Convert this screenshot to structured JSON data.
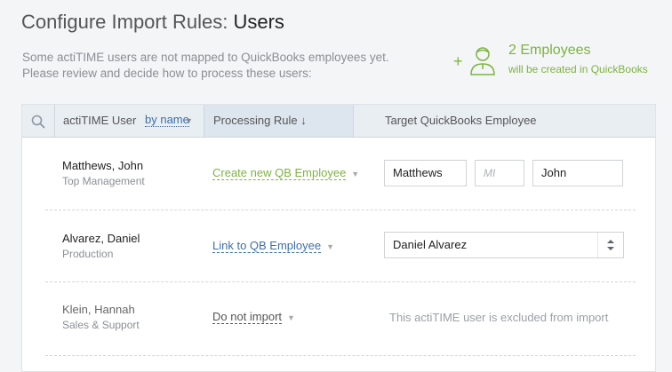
{
  "page": {
    "title_prefix": "Configure Import Rules:",
    "title_subject": "Users",
    "description_line1": "Some actiTIME users are not mapped to QuickBooks employees yet.",
    "description_line2": "Please review and decide how to process these users:"
  },
  "summary": {
    "plus": "+",
    "count": "2 Employees",
    "subtitle": "will be created in QuickBooks",
    "icon": "user-add-icon",
    "color": "#7cb342"
  },
  "table": {
    "columns": {
      "user": "actiTIME User",
      "sort_by": "by name",
      "processing_rule": "Processing Rule ↓",
      "target": "Target QuickBooks Employee"
    },
    "rows": [
      {
        "name": "Matthews, John",
        "department": "Top Management",
        "rule": "Create new QB Employee",
        "last_name": "Matthews",
        "middle_initial_placeholder": "MI",
        "first_name": "John"
      },
      {
        "name": "Alvarez, Daniel",
        "department": "Production",
        "rule": "Link to QB Employee",
        "linked_employee": "Daniel Alvarez"
      },
      {
        "name": "Klein, Hannah",
        "department": "Sales & Support",
        "rule": "Do not import",
        "note": "This actiTIME user is excluded from import"
      }
    ]
  },
  "colors": {
    "accent_green": "#7cb342",
    "link_blue": "#3c6fa8",
    "header_bg": "#e9eef3"
  }
}
